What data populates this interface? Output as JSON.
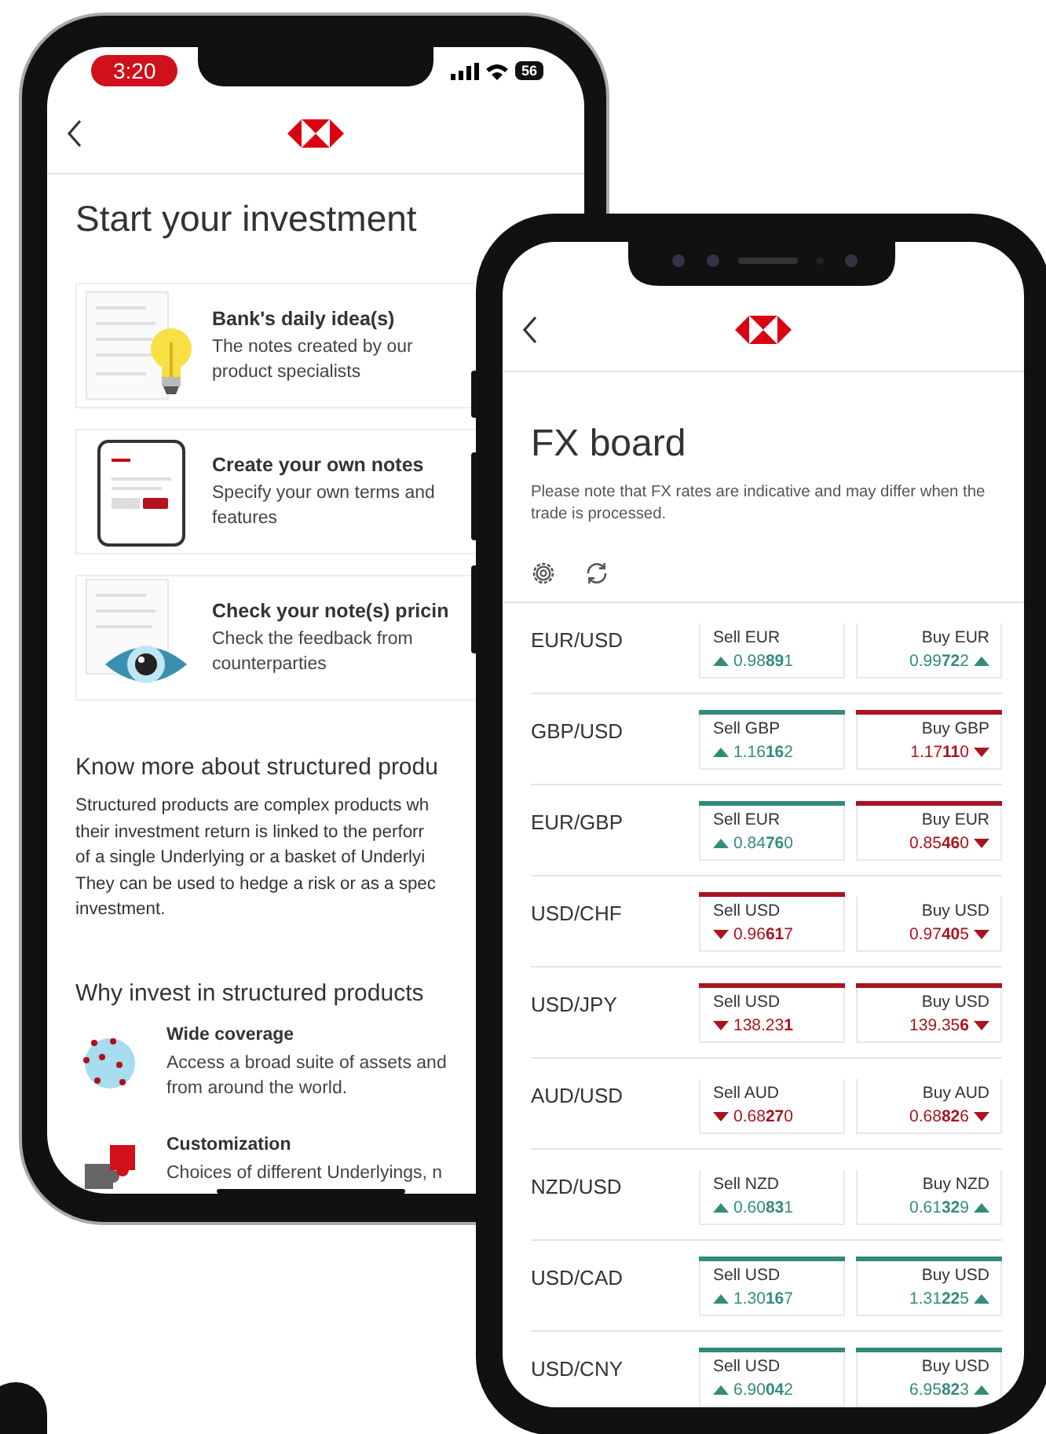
{
  "investment_screen": {
    "status_bar": {
      "time": "3:20",
      "battery": "56"
    },
    "title": "Start your investment",
    "cards": [
      {
        "kind": "idea",
        "title": "Bank's daily idea(s)",
        "description": "The notes created by our product specialists"
      },
      {
        "kind": "create",
        "title": "Create your own notes",
        "description": "Specify your own terms and features"
      },
      {
        "kind": "pricing",
        "title": "Check your note(s) pricin",
        "description": "Check the feedback from counterparties"
      }
    ],
    "know_more": {
      "heading": "Know more about structured produ",
      "lines": [
        "Structured products are complex products wh",
        "their investment return is linked to the perforr",
        "of a single Underlying or a basket of Underlyi",
        "They can be used to hedge a risk or as a spec",
        "investment."
      ]
    },
    "why_invest": {
      "heading": "Why invest in structured products",
      "features": [
        {
          "kind": "globe",
          "title": "Wide coverage",
          "lines": [
            "Access a broad suite of assets and",
            "from around the world."
          ]
        },
        {
          "kind": "puzzle",
          "title": "Customization",
          "lines": [
            "Choices of different Underlyings, n"
          ]
        }
      ]
    }
  },
  "fx_screen": {
    "title": "FX board",
    "note": "Please note that FX rates are indicative and may differ when the trade is processed.",
    "rows": [
      {
        "pair": "EUR/USD",
        "quotes": [
          {
            "label": "Sell EUR",
            "rising": true,
            "rate": "0.98**89**1"
          },
          {
            "label": "Buy EUR",
            "rising": true,
            "rate": "0.99**72**2"
          }
        ]
      },
      {
        "pair": "GBP/USD",
        "quotes": [
          {
            "label": "Sell GBP",
            "rising": true,
            "rate": "1.16**16**2",
            "color": "#338b7c"
          },
          {
            "label": "Buy GBP",
            "rising": false,
            "rate": "1.17**11**0",
            "color": "#a8141f"
          }
        ]
      },
      {
        "pair": "EUR/GBP",
        "quotes": [
          {
            "label": "Sell EUR",
            "rising": true,
            "rate": "0.84**76**0",
            "color": "#338b7c"
          },
          {
            "label": "Buy EUR",
            "rising": false,
            "rate": "0.85**46**0",
            "color": "#a8141f"
          }
        ]
      },
      {
        "pair": "USD/CHF",
        "quotes": [
          {
            "label": "Sell USD",
            "rising": false,
            "rate": "0.96**61**7",
            "color": "#a8141f"
          },
          {
            "label": "Buy USD",
            "rising": false,
            "rate": "0.97**40**5"
          }
        ]
      },
      {
        "pair": "USD/JPY",
        "quotes": [
          {
            "label": "Sell USD",
            "rising": false,
            "rate": "138.23**1**",
            "color": "#a8141f"
          },
          {
            "label": "Buy USD",
            "rising": false,
            "rate": "139.35**6**",
            "color": "#a8141f"
          }
        ]
      },
      {
        "pair": "AUD/USD",
        "quotes": [
          {
            "label": "Sell AUD",
            "rising": false,
            "rate": "0.68**27**0"
          },
          {
            "label": "Buy AUD",
            "rising": false,
            "rate": "0.68**82**6"
          }
        ]
      },
      {
        "pair": "NZD/USD",
        "quotes": [
          {
            "label": "Sell NZD",
            "rising": true,
            "rate": "0.60**83**1"
          },
          {
            "label": "Buy NZD",
            "rising": true,
            "rate": "0.61**32**9"
          }
        ]
      },
      {
        "pair": "USD/CAD",
        "quotes": [
          {
            "label": "Sell USD",
            "rising": true,
            "rate": "1.30**16**7",
            "color": "#338b7c"
          },
          {
            "label": "Buy USD",
            "rising": true,
            "rate": "1.31**22**5",
            "color": "#338b7c"
          }
        ]
      },
      {
        "pair": "USD/CNY",
        "quotes": [
          {
            "label": "Sell USD",
            "rising": true,
            "rate": "6.90**04**2",
            "color": "#338b7c"
          },
          {
            "label": "Buy USD",
            "rising": true,
            "rate": "6.95**82**3",
            "color": "#338b7c"
          }
        ]
      }
    ]
  }
}
